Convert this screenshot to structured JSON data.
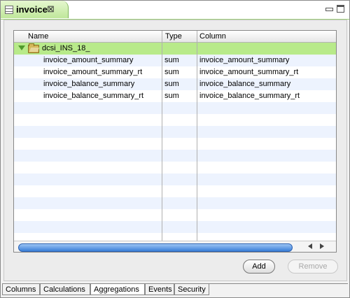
{
  "editor": {
    "tab_title": "invoice",
    "close_glyph": "⊠",
    "icon": "table-icon"
  },
  "table": {
    "columns": [
      "Name",
      "Type",
      "Column"
    ],
    "group": {
      "label": "dcsi_INS_18_",
      "expanded": true,
      "icon": "folder-open-icon"
    },
    "rows": [
      {
        "name": "invoice_amount_summary",
        "type": "sum",
        "column": "invoice_amount_summary"
      },
      {
        "name": "invoice_amount_summary_rt",
        "type": "sum",
        "column": "invoice_amount_summary_rt"
      },
      {
        "name": "invoice_balance_summary",
        "type": "sum",
        "column": "invoice_balance_summary"
      },
      {
        "name": "invoice_balance_summary_rt",
        "type": "sum",
        "column": "invoice_balance_summary_rt"
      }
    ]
  },
  "buttons": {
    "add": "Add",
    "remove": "Remove"
  },
  "bottom_tabs": [
    "Columns",
    "Calculations",
    "Aggregations",
    "Events",
    "Security"
  ],
  "active_tab": "Aggregations",
  "colors": {
    "group_row": "#b8ea8a",
    "alt_row": "#edf3fe",
    "scroll_thumb": "#3a7fd8"
  }
}
